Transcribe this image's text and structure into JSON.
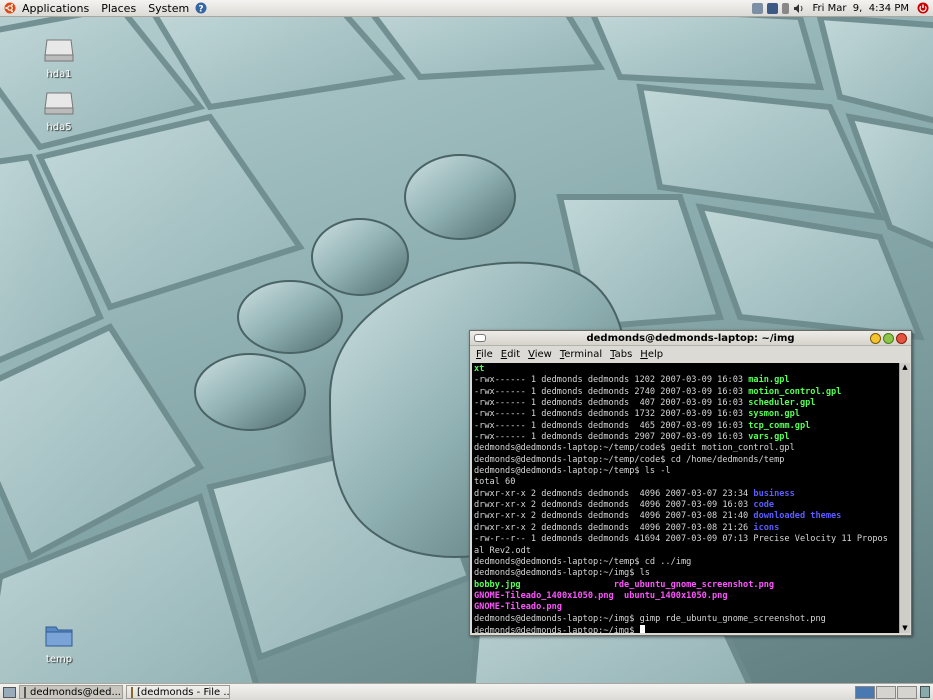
{
  "top_panel": {
    "menus": [
      "Applications",
      "Places",
      "System"
    ],
    "clock": "Fri Mar  9,  4:34 PM"
  },
  "desktop_icons": [
    {
      "label": "hda1",
      "icon": "harddisk-icon"
    },
    {
      "label": "hda5",
      "icon": "harddisk-icon"
    },
    {
      "label": "temp",
      "icon": "folder-icon"
    }
  ],
  "terminal": {
    "title": "dedmonds@dedmonds-laptop: ~/img",
    "menus": [
      "File",
      "Edit",
      "View",
      "Terminal",
      "Tabs",
      "Help"
    ],
    "lines": [
      [
        {
          "t": "xt",
          "c": "g"
        }
      ],
      [
        {
          "t": "-rwx------ 1 dedmonds dedmonds 1202 2007-03-09 16:03 "
        },
        {
          "t": "main.gpl",
          "c": "g"
        }
      ],
      [
        {
          "t": "-rwx------ 1 dedmonds dedmonds 2740 2007-03-09 16:03 "
        },
        {
          "t": "motion_control.gpl",
          "c": "g"
        }
      ],
      [
        {
          "t": "-rwx------ 1 dedmonds dedmonds  407 2007-03-09 16:03 "
        },
        {
          "t": "scheduler.gpl",
          "c": "g"
        }
      ],
      [
        {
          "t": "-rwx------ 1 dedmonds dedmonds 1732 2007-03-09 16:03 "
        },
        {
          "t": "sysmon.gpl",
          "c": "g"
        }
      ],
      [
        {
          "t": "-rwx------ 1 dedmonds dedmonds  465 2007-03-09 16:03 "
        },
        {
          "t": "tcp_comm.gpl",
          "c": "g"
        }
      ],
      [
        {
          "t": "-rwx------ 1 dedmonds dedmonds 2907 2007-03-09 16:03 "
        },
        {
          "t": "vars.gpl",
          "c": "g"
        }
      ],
      [
        {
          "t": "dedmonds@dedmonds-laptop:~/temp/code$ gedit motion_control.gpl"
        }
      ],
      [
        {
          "t": "dedmonds@dedmonds-laptop:~/temp/code$ cd /home/dedmonds/temp"
        }
      ],
      [
        {
          "t": "dedmonds@dedmonds-laptop:~/temp$ ls -l"
        }
      ],
      [
        {
          "t": "total 60"
        }
      ],
      [
        {
          "t": "drwxr-xr-x 2 dedmonds dedmonds  4096 2007-03-07 23:34 "
        },
        {
          "t": "business",
          "c": "b"
        }
      ],
      [
        {
          "t": "drwxr-xr-x 2 dedmonds dedmonds  4096 2007-03-09 16:03 "
        },
        {
          "t": "code",
          "c": "b"
        }
      ],
      [
        {
          "t": "drwxr-xr-x 2 dedmonds dedmonds  4096 2007-03-08 21:40 "
        },
        {
          "t": "downloaded themes",
          "c": "b"
        }
      ],
      [
        {
          "t": "drwxr-xr-x 2 dedmonds dedmonds  4096 2007-03-08 21:26 "
        },
        {
          "t": "icons",
          "c": "b"
        }
      ],
      [
        {
          "t": "-rw-r--r-- 1 dedmonds dedmonds 41694 2007-03-09 07:13 Precise Velocity 11 Propos"
        }
      ],
      [
        {
          "t": "al Rev2.odt"
        }
      ],
      [
        {
          "t": "dedmonds@dedmonds-laptop:~/temp$ cd ../img"
        }
      ],
      [
        {
          "t": "dedmonds@dedmonds-laptop:~/img$ ls"
        }
      ],
      [
        {
          "t": "bobby.jpg                  ",
          "c": "g"
        },
        {
          "t": "rde_ubuntu_gnome_screenshot.png",
          "c": "m"
        }
      ],
      [
        {
          "t": "GNOME-Tileado_1400x1050.png  ",
          "c": "m"
        },
        {
          "t": "ubuntu_1400x1050.png",
          "c": "m"
        }
      ],
      [
        {
          "t": "GNOME-Tileado.png",
          "c": "m"
        }
      ],
      [
        {
          "t": "dedmonds@dedmonds-laptop:~/img$ gimp rde_ubuntu_gnome_screenshot.png"
        }
      ],
      [
        {
          "t": "dedmonds@dedmonds-laptop:~/img$ "
        }
      ]
    ]
  },
  "bottom_panel": {
    "tasks": [
      {
        "label": "dedmonds@ded...",
        "icon": "terminal-icon"
      },
      {
        "label": "[dedmonds - File ...",
        "icon": "file-manager-icon"
      }
    ]
  },
  "colors": {
    "panel": "#dcdad5",
    "terminal_bg": "#000000",
    "ls_exec": "#55ff55",
    "ls_dir": "#5c5cff",
    "ls_image": "#ff55ff"
  }
}
